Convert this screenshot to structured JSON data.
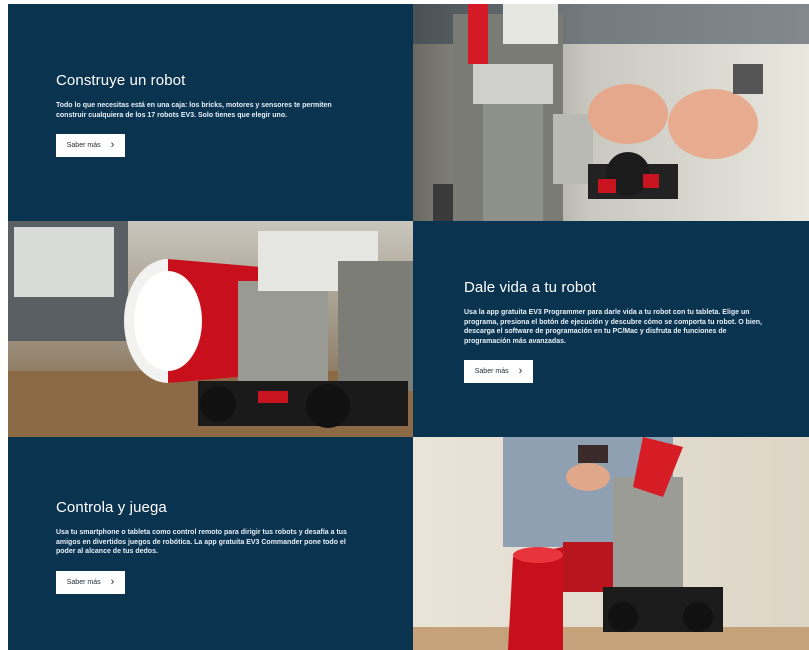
{
  "sections": [
    {
      "title": "Construye un robot",
      "body": "Todo lo que necesitas está en una caja: los bricks, motores y sensores te permiten construir cualquiera de los 17 robots EV3. Solo tienes que elegir uno.",
      "button_label": "Saber más",
      "button_icon": "chevron-right-icon"
    },
    {
      "title": "Dale vida a tu robot",
      "body": "Usa la app gratuita EV3 Programmer para darle vida a tu robot con tu tableta. Elige un programa, presiona el botón de ejecución y descubre cómo se comporta tu robot. O bien, descarga el software de programación en tu PC/Mac y disfruta de funciones de programación más avanzadas.",
      "button_label": "Saber más",
      "button_icon": "chevron-right-icon"
    },
    {
      "title": "Controla y juega",
      "body": "Usa tu smartphone o tableta como control remoto para dirigir tus robots y desafía a tus amigos en divertidos juegos de robótica. La app gratuita EV3 Commander pone todo el poder al alcance de tus dedos.",
      "button_label": "Saber más",
      "button_icon": "chevron-right-icon"
    }
  ],
  "colors": {
    "panel_bg": "#0a3350",
    "button_bg": "#ffffff",
    "accent_red": "#d0101c"
  }
}
